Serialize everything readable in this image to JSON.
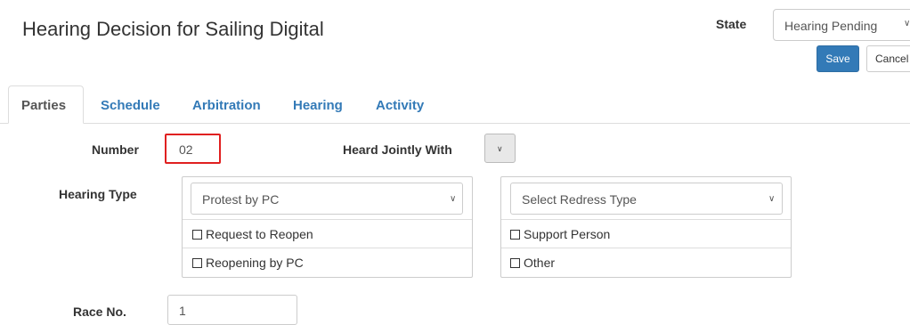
{
  "header": {
    "title": "Hearing Decision for Sailing Digital",
    "state_label": "State",
    "state_value": "Hearing Pending",
    "save_label": "Save",
    "cancel_label": "Cancel"
  },
  "tabs": [
    {
      "label": "Parties",
      "active": true
    },
    {
      "label": "Schedule",
      "active": false
    },
    {
      "label": "Arbitration",
      "active": false
    },
    {
      "label": "Hearing",
      "active": false
    },
    {
      "label": "Activity",
      "active": false
    }
  ],
  "form": {
    "number_label": "Number",
    "number_value": "02",
    "heard_jointly_label": "Heard Jointly With",
    "hearing_type_label": "Hearing Type",
    "hearing_type_value": "Protest by PC",
    "redress_placeholder": "Select Redress Type",
    "checkboxes_left": [
      {
        "label": "Request to Reopen",
        "checked": false
      },
      {
        "label": "Reopening by PC",
        "checked": false
      }
    ],
    "checkboxes_right": [
      {
        "label": "Support Person",
        "checked": false
      },
      {
        "label": "Other",
        "checked": false
      }
    ],
    "race_label": "Race No.",
    "race_value": "1"
  },
  "colors": {
    "primary": "#337ab7",
    "highlight_border": "#e02020"
  },
  "icons": {
    "select_chevron": "chevron-down-icon"
  }
}
